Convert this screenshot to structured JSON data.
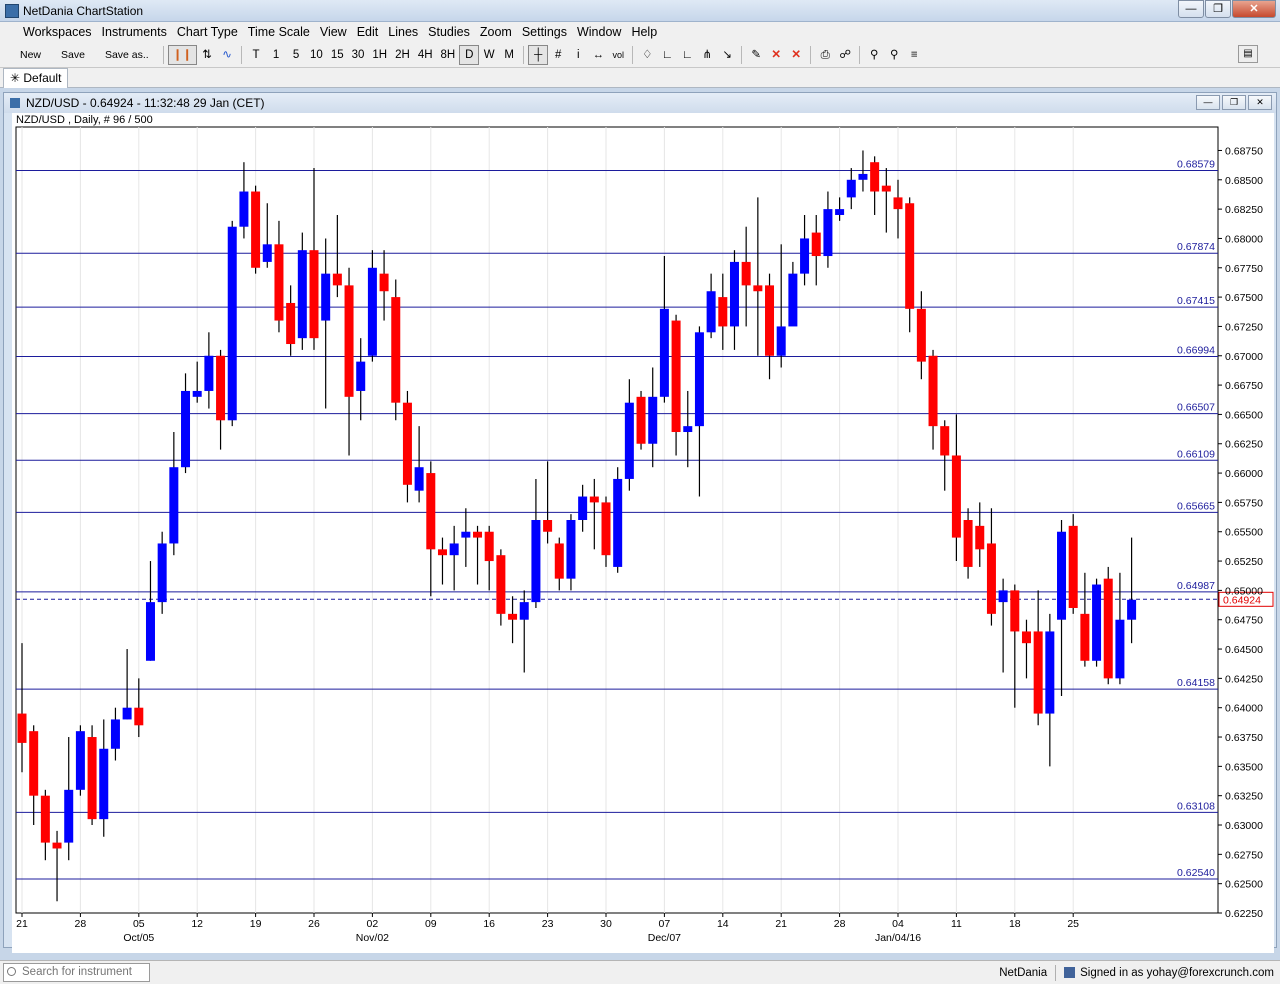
{
  "app": {
    "title": "NetDania ChartStation"
  },
  "menu": [
    "Workspaces",
    "Instruments",
    "Chart Type",
    "Time Scale",
    "View",
    "Edit",
    "Lines",
    "Studies",
    "Zoom",
    "Settings",
    "Window",
    "Help"
  ],
  "toolbar": {
    "new_label": "New",
    "save_label": "Save",
    "save_as_label": "Save as..",
    "timescales": [
      "T",
      "1",
      "5",
      "10",
      "15",
      "30",
      "1H",
      "2H",
      "4H",
      "8H",
      "D",
      "W",
      "M"
    ],
    "selected_timescale": "D"
  },
  "tabs": [
    {
      "label": "Default"
    }
  ],
  "chart_window": {
    "title": "NZD/USD - 0.64924 - 11:32:48  29 Jan (CET)",
    "info": "NZD/USD , Daily, # 96 / 500"
  },
  "status": {
    "search_placeholder": "Search for instrument",
    "brand": "NetDania",
    "signed_in": "Signed in as yohay@forexcrunch.com"
  },
  "colors": {
    "up": "#0000ff",
    "down": "#ff0000",
    "line": "#1c1c9c"
  },
  "chart_data": {
    "type": "candlestick",
    "instrument": "NZD/USD",
    "ylim": [
      0.6225,
      0.6895
    ],
    "y_ticks": [
      "0.62250",
      "0.62500",
      "0.62750",
      "0.63000",
      "0.63250",
      "0.63500",
      "0.63750",
      "0.64000",
      "0.64250",
      "0.64500",
      "0.64750",
      "0.65000",
      "0.65250",
      "0.65500",
      "0.65750",
      "0.66000",
      "0.66250",
      "0.66500",
      "0.66750",
      "0.67000",
      "0.67250",
      "0.67500",
      "0.67750",
      "0.68000",
      "0.68250",
      "0.68500",
      "0.68750"
    ],
    "x_ticks": [
      {
        "day": "21",
        "i": 0
      },
      {
        "day": "28",
        "i": 5
      },
      {
        "day": "05",
        "month": "Oct/05",
        "i": 10
      },
      {
        "day": "12",
        "i": 15
      },
      {
        "day": "19",
        "i": 20
      },
      {
        "day": "26",
        "i": 25
      },
      {
        "day": "02",
        "month": "Nov/02",
        "i": 30
      },
      {
        "day": "09",
        "i": 35
      },
      {
        "day": "16",
        "i": 40
      },
      {
        "day": "23",
        "i": 45
      },
      {
        "day": "30",
        "i": 50
      },
      {
        "day": "07",
        "month": "Dec/07",
        "i": 55
      },
      {
        "day": "14",
        "i": 60
      },
      {
        "day": "21",
        "i": 65
      },
      {
        "day": "28",
        "i": 70
      },
      {
        "day": "04",
        "month": "Jan/04/16",
        "i": 75
      },
      {
        "day": "11",
        "i": 80
      },
      {
        "day": "18",
        "i": 85
      },
      {
        "day": "25",
        "i": 90
      }
    ],
    "current_price": 0.64924,
    "current_price_label": "0.64924",
    "horizontal_lines": [
      {
        "value": 0.68579,
        "label": "0.68579"
      },
      {
        "value": 0.67874,
        "label": "0.67874"
      },
      {
        "value": 0.67415,
        "label": "0.67415"
      },
      {
        "value": 0.66994,
        "label": "0.66994"
      },
      {
        "value": 0.66507,
        "label": "0.66507"
      },
      {
        "value": 0.66109,
        "label": "0.66109"
      },
      {
        "value": 0.65665,
        "label": "0.65665"
      },
      {
        "value": 0.64987,
        "label": "0.64987"
      },
      {
        "value": 0.64158,
        "label": "0.64158"
      },
      {
        "value": 0.63108,
        "label": "0.63108"
      },
      {
        "value": 0.6254,
        "label": "0.62540"
      }
    ],
    "candles": [
      [
        0.6395,
        0.637,
        0.6455,
        0.6345
      ],
      [
        0.638,
        0.6325,
        0.6385,
        0.63
      ],
      [
        0.6325,
        0.6285,
        0.633,
        0.627
      ],
      [
        0.6285,
        0.628,
        0.6295,
        0.6235
      ],
      [
        0.6285,
        0.633,
        0.6375,
        0.627
      ],
      [
        0.633,
        0.638,
        0.6385,
        0.6325
      ],
      [
        0.6375,
        0.6305,
        0.6385,
        0.63
      ],
      [
        0.6305,
        0.6365,
        0.639,
        0.629
      ],
      [
        0.6365,
        0.639,
        0.64,
        0.6355
      ],
      [
        0.639,
        0.64,
        0.645,
        0.639
      ],
      [
        0.64,
        0.6385,
        0.6425,
        0.6375
      ],
      [
        0.644,
        0.649,
        0.6525,
        0.644
      ],
      [
        0.649,
        0.654,
        0.655,
        0.648
      ],
      [
        0.654,
        0.6605,
        0.6635,
        0.653
      ],
      [
        0.6605,
        0.667,
        0.6685,
        0.66
      ],
      [
        0.6665,
        0.667,
        0.6695,
        0.666
      ],
      [
        0.667,
        0.67,
        0.672,
        0.6655
      ],
      [
        0.67,
        0.6645,
        0.6705,
        0.662
      ],
      [
        0.6645,
        0.681,
        0.6815,
        0.664
      ],
      [
        0.681,
        0.684,
        0.6865,
        0.68
      ],
      [
        0.684,
        0.6775,
        0.6845,
        0.677
      ],
      [
        0.678,
        0.6795,
        0.683,
        0.6775
      ],
      [
        0.6795,
        0.673,
        0.6815,
        0.672
      ],
      [
        0.6745,
        0.671,
        0.676,
        0.67
      ],
      [
        0.6715,
        0.679,
        0.6805,
        0.6705
      ],
      [
        0.679,
        0.6715,
        0.686,
        0.6705
      ],
      [
        0.673,
        0.677,
        0.68,
        0.6655
      ],
      [
        0.677,
        0.676,
        0.682,
        0.675
      ],
      [
        0.676,
        0.6665,
        0.6775,
        0.6615
      ],
      [
        0.667,
        0.6695,
        0.6715,
        0.6645
      ],
      [
        0.67,
        0.6775,
        0.679,
        0.6695
      ],
      [
        0.677,
        0.6755,
        0.679,
        0.673
      ],
      [
        0.675,
        0.666,
        0.6765,
        0.6645
      ],
      [
        0.666,
        0.659,
        0.667,
        0.6575
      ],
      [
        0.6585,
        0.6605,
        0.664,
        0.6575
      ],
      [
        0.66,
        0.6535,
        0.661,
        0.6495
      ],
      [
        0.6535,
        0.653,
        0.6545,
        0.6505
      ],
      [
        0.653,
        0.654,
        0.6555,
        0.65
      ],
      [
        0.6545,
        0.655,
        0.657,
        0.652
      ],
      [
        0.655,
        0.6545,
        0.6555,
        0.6505
      ],
      [
        0.655,
        0.6525,
        0.6555,
        0.65
      ],
      [
        0.653,
        0.648,
        0.6535,
        0.647
      ],
      [
        0.648,
        0.6475,
        0.6495,
        0.6455
      ],
      [
        0.6475,
        0.649,
        0.65,
        0.643
      ],
      [
        0.649,
        0.656,
        0.6595,
        0.6485
      ],
      [
        0.656,
        0.655,
        0.661,
        0.654
      ],
      [
        0.654,
        0.651,
        0.6545,
        0.65
      ],
      [
        0.651,
        0.656,
        0.6565,
        0.65
      ],
      [
        0.656,
        0.658,
        0.659,
        0.655
      ],
      [
        0.658,
        0.6575,
        0.6595,
        0.6535
      ],
      [
        0.6575,
        0.653,
        0.658,
        0.652
      ],
      [
        0.652,
        0.6595,
        0.6605,
        0.6515
      ],
      [
        0.6595,
        0.666,
        0.668,
        0.6585
      ],
      [
        0.6665,
        0.6625,
        0.667,
        0.662
      ],
      [
        0.6625,
        0.6665,
        0.669,
        0.6605
      ],
      [
        0.6665,
        0.674,
        0.6785,
        0.666
      ],
      [
        0.673,
        0.6635,
        0.6735,
        0.6615
      ],
      [
        0.6635,
        0.664,
        0.667,
        0.6605
      ],
      [
        0.664,
        0.672,
        0.6725,
        0.658
      ],
      [
        0.672,
        0.6755,
        0.677,
        0.6715
      ],
      [
        0.675,
        0.6725,
        0.677,
        0.6705
      ],
      [
        0.6725,
        0.678,
        0.679,
        0.6705
      ],
      [
        0.678,
        0.676,
        0.681,
        0.6725
      ],
      [
        0.676,
        0.6755,
        0.6835,
        0.67
      ],
      [
        0.676,
        0.67,
        0.677,
        0.668
      ],
      [
        0.67,
        0.6725,
        0.6795,
        0.669
      ],
      [
        0.6725,
        0.677,
        0.678,
        0.675
      ],
      [
        0.677,
        0.68,
        0.682,
        0.676
      ],
      [
        0.6805,
        0.6785,
        0.682,
        0.676
      ],
      [
        0.6785,
        0.6825,
        0.684,
        0.6775
      ],
      [
        0.682,
        0.6825,
        0.6835,
        0.6815
      ],
      [
        0.6835,
        0.685,
        0.686,
        0.6825
      ],
      [
        0.685,
        0.6855,
        0.6875,
        0.684
      ],
      [
        0.6865,
        0.684,
        0.687,
        0.682
      ],
      [
        0.6845,
        0.684,
        0.686,
        0.6805
      ],
      [
        0.6835,
        0.6825,
        0.685,
        0.68
      ],
      [
        0.683,
        0.674,
        0.6835,
        0.672
      ],
      [
        0.674,
        0.6695,
        0.6755,
        0.668
      ],
      [
        0.67,
        0.664,
        0.6705,
        0.662
      ],
      [
        0.664,
        0.6615,
        0.6645,
        0.6585
      ],
      [
        0.6615,
        0.6545,
        0.665,
        0.6525
      ],
      [
        0.656,
        0.652,
        0.657,
        0.651
      ],
      [
        0.6555,
        0.6535,
        0.6575,
        0.652
      ],
      [
        0.654,
        0.648,
        0.657,
        0.647
      ],
      [
        0.649,
        0.65,
        0.651,
        0.643
      ],
      [
        0.65,
        0.6465,
        0.6505,
        0.64
      ],
      [
        0.6465,
        0.6455,
        0.6475,
        0.6425
      ],
      [
        0.6465,
        0.6395,
        0.65,
        0.6385
      ],
      [
        0.6395,
        0.6465,
        0.648,
        0.635
      ],
      [
        0.6475,
        0.655,
        0.656,
        0.641
      ],
      [
        0.6555,
        0.6485,
        0.6565,
        0.648
      ],
      [
        0.648,
        0.644,
        0.6515,
        0.6435
      ],
      [
        0.644,
        0.6505,
        0.651,
        0.6435
      ],
      [
        0.651,
        0.6425,
        0.652,
        0.642
      ],
      [
        0.6425,
        0.6475,
        0.6515,
        0.642
      ],
      [
        0.6475,
        0.6492,
        0.6545,
        0.6455
      ]
    ]
  }
}
